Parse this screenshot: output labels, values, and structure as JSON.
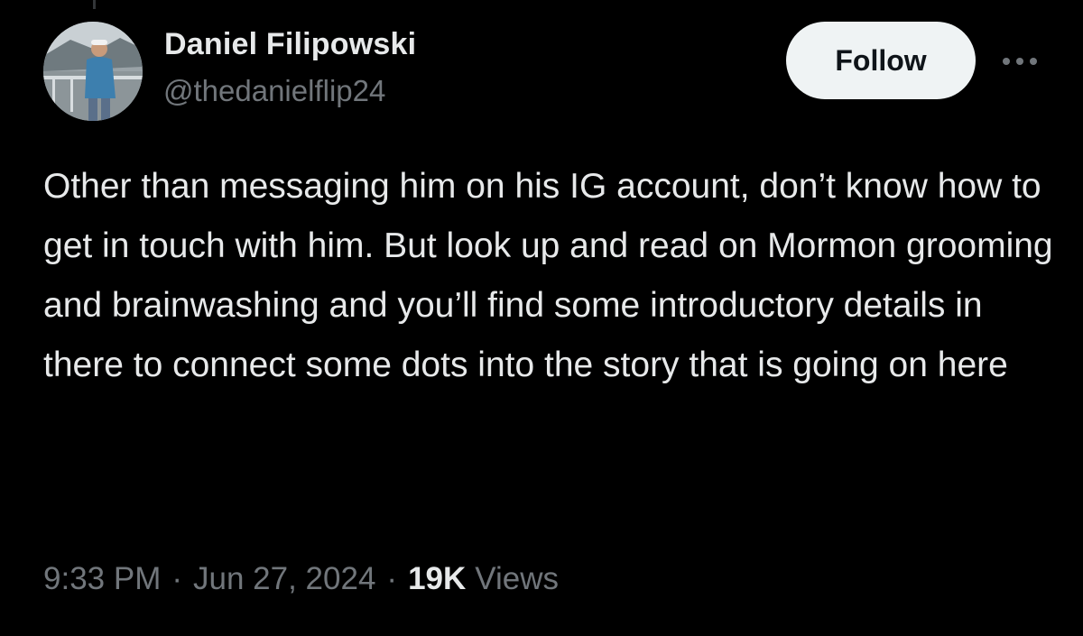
{
  "tweet": {
    "author": {
      "display_name": "Daniel Filipowski",
      "handle": "@thedanielflip24",
      "avatar_icon": "profile-photo"
    },
    "follow_label": "Follow",
    "more_icon": "more-horizontal-icon",
    "text": "Other than messaging him on his IG account, don’t know how to get in touch with him. But look up and read on Mormon grooming and brainwashing and you’ll find some introductory details in there to connect some dots into the story that is going on here",
    "time": "9:33 PM",
    "date": "Jun 27, 2024",
    "separator": "·",
    "views_count": "19K",
    "views_label": "Views"
  },
  "colors": {
    "background": "#000000",
    "primary_text": "#e7e9ea",
    "secondary_text": "#71767b",
    "follow_button_bg": "#eff3f4",
    "follow_button_text": "#0f1419"
  }
}
